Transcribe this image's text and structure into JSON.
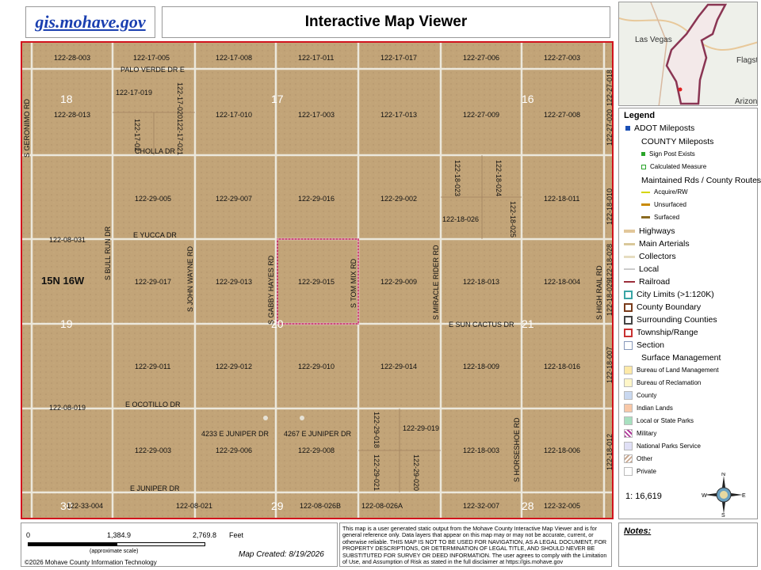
{
  "header": {
    "site_link": "gis.mohave.gov",
    "title": "Interactive Map Viewer"
  },
  "inset_map": {
    "labels": [
      "Las Vegas",
      "Flagsta",
      "Arizon"
    ]
  },
  "map": {
    "township_label": "15N 16W",
    "sections": [
      "18",
      "17",
      "16",
      "19",
      "20",
      "21",
      "30",
      "29",
      "28"
    ],
    "parcels": [
      "122-28-003",
      "122-17-005",
      "122-17-008",
      "122-17-011",
      "122-17-017",
      "122-27-006",
      "122-27-003",
      "122-28-013",
      "122-17-019",
      "122-17-020",
      "122-17-010",
      "122-17-003",
      "122-17-013",
      "122-27-009",
      "122-27-008",
      "122-17-021",
      "122-17-02",
      "122-27-020",
      "122-29-005",
      "122-29-007",
      "122-29-016",
      "122-29-002",
      "122-18-023",
      "122-18-024",
      "122-18-011",
      "122-18-026",
      "122-18-025",
      "122-08-031",
      "122-18-010",
      "122-29-017",
      "122-29-013",
      "122-29-015",
      "122-29-009",
      "122-18-013",
      "122-18-004",
      "122-18-028",
      "122-18-029",
      "122-29-011",
      "122-29-012",
      "122-29-010",
      "122-29-014",
      "122-18-009",
      "122-18-016",
      "122-18-007",
      "122-08-019",
      "122-29-018",
      "122-29-019",
      "4233 E JUNIPER DR",
      "4267 E JUNIPER DR",
      "122-29-003",
      "122-29-006",
      "122-29-008",
      "122-18-003",
      "122-18-006",
      "122-29-021",
      "122-29-020",
      "122-18-012",
      "122-33-004",
      "122-08-021",
      "122-08-026B",
      "122-08-026A",
      "122-32-007",
      "122-32-005",
      "122-27-018"
    ],
    "roads": [
      "PALO VERDE DR E",
      "S GERONIMO RD",
      "CHOLLA DR",
      "S BULL RUN DR",
      "E YUCCA DR",
      "S JOHN WAYNE RD",
      "S GABBY HAYES RD",
      "S TOM MIX RD",
      "S MIRACLE RIDER RD",
      "S HIGH RAIL RD",
      "E SUN CACTUS DR",
      "E OCOTILLO DR",
      "S HORSESHOE RD",
      "E JUNIPER DR"
    ]
  },
  "legend": {
    "title": "Legend",
    "items": [
      {
        "label": "ADOT Mileposts",
        "color": "#1a4fb5"
      },
      {
        "label": "COUNTY Mileposts"
      },
      {
        "label": "Sign Post Exists",
        "color": "#2aa52a"
      },
      {
        "label": "Calculated Measure",
        "color": "#8fd08f"
      },
      {
        "label": "Maintained Rds / County Routes"
      },
      {
        "label": "Acquire/RW",
        "color": "#d6d600"
      },
      {
        "label": "Unsurfaced",
        "color": "#c98a00"
      },
      {
        "label": "Surfaced",
        "color": "#8a6a20"
      },
      {
        "label": "Highways",
        "color": "#e2c79a"
      },
      {
        "label": "Main Arterials",
        "color": "#d9c89a"
      },
      {
        "label": "Collectors",
        "color": "#e6ddc0"
      },
      {
        "label": "Local",
        "color": "#eeeeee"
      },
      {
        "label": "Railroad",
        "color": "#9b2d3a"
      },
      {
        "label": "City Limits (>1:120K)",
        "color": "#3aa5a5"
      },
      {
        "label": "County Boundary",
        "color": "#7a3b1a"
      },
      {
        "label": "Surrounding Counties",
        "color": "#444444"
      },
      {
        "label": "Township/Range",
        "color": "#c83232"
      },
      {
        "label": "Section",
        "color": "#8899bb"
      },
      {
        "label": "Surface Management"
      },
      {
        "label": "Bureau of Land Management",
        "color": "#fde9a8"
      },
      {
        "label": "Bureau of Reclamation",
        "color": "#fff6c8"
      },
      {
        "label": "County",
        "color": "#c9d8f0"
      },
      {
        "label": "Indian Lands",
        "color": "#f8c8a8"
      },
      {
        "label": "Local or State Parks",
        "color": "#a8e0c0"
      },
      {
        "label": "Military",
        "color": "#b03a9a"
      },
      {
        "label": "National Parks Service",
        "color": "#e0e0f6"
      },
      {
        "label": "Other",
        "color": "#c8a890"
      },
      {
        "label": "Private",
        "color": "#ffffff"
      }
    ],
    "scale": "1: 16,619"
  },
  "scale_bar": {
    "ticks": [
      "0",
      "1,384.9",
      "2,769.8"
    ],
    "unit": "Feet",
    "note": "(approximate scale)"
  },
  "footer": {
    "credit": "©2026 Mohave County Information Technology",
    "map_created": "Map Created: 8/19/2026",
    "disclaimer": "This map is a user generated static output from the Mohave County Interactive Map Viewer and is for general reference only. Data layers that appear on this map may or may not be accurate, current, or otherwise reliable. THIS MAP IS NOT TO BE USED FOR NAVIGATION, AS A LEGAL DOCUMENT, FOR PROPERTY DESCRIPTIONS, OR DETERMINATION OF LEGAL TITLE, AND SHOULD NEVER BE SUBSTITUTED FOR SURVEY OR DEED INFORMATION. The user agrees to comply with the Limitation of Use, and Assumption of Risk as stated in the full disclaimer at https://gis.mohave.gov",
    "notes_label": "Notes:"
  },
  "colors": {
    "parcel_fill": "#c2a478",
    "road": "#ece8dc",
    "highlight": "#c2185b",
    "frame": "#d2141e",
    "link": "#1a3fb0"
  }
}
